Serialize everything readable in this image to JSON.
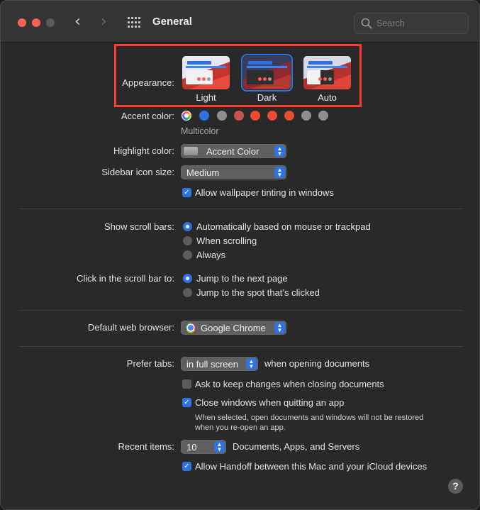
{
  "window": {
    "title": "General"
  },
  "toolbar": {
    "back_glyph": "‹",
    "forward_glyph": "›",
    "search_placeholder": "Search"
  },
  "appearance": {
    "label": "Appearance:",
    "options": [
      {
        "label": "Light",
        "selected": false
      },
      {
        "label": "Dark",
        "selected": true
      },
      {
        "label": "Auto",
        "selected": false
      }
    ]
  },
  "accent": {
    "label": "Accent color:",
    "selected_name": "Multicolor",
    "swatches": [
      "#2d73e3",
      "#8e8e8e",
      "#c8534a",
      "#ee4a33",
      "#ee4a33",
      "#e14e34",
      "#8e8e8e",
      "#8e8e8e"
    ]
  },
  "highlight": {
    "label": "Highlight color:",
    "value": "Accent Color"
  },
  "sidebar_size": {
    "label": "Sidebar icon size:",
    "value": "Medium"
  },
  "wallpaper_tinting": {
    "label": "Allow wallpaper tinting in windows",
    "checked": true
  },
  "scroll_bars": {
    "label": "Show scroll bars:",
    "options": [
      {
        "label": "Automatically based on mouse or trackpad",
        "selected": true
      },
      {
        "label": "When scrolling",
        "selected": false
      },
      {
        "label": "Always",
        "selected": false
      }
    ]
  },
  "scroll_click": {
    "label": "Click in the scroll bar to:",
    "options": [
      {
        "label": "Jump to the next page",
        "selected": true
      },
      {
        "label": "Jump to the spot that’s clicked",
        "selected": false
      }
    ]
  },
  "browser": {
    "label": "Default web browser:",
    "value": "Google Chrome"
  },
  "tabs": {
    "label": "Prefer tabs:",
    "value": "in full screen",
    "suffix": "when opening documents"
  },
  "ask_keep_changes": {
    "label": "Ask to keep changes when closing documents",
    "checked": false
  },
  "close_windows": {
    "label": "Close windows when quitting an app",
    "checked": true,
    "note_line1": "When selected, open documents and windows will not be restored",
    "note_line2": "when you re-open an app."
  },
  "recent_items": {
    "label": "Recent items:",
    "value": "10",
    "suffix": "Documents, Apps, and Servers"
  },
  "handoff": {
    "label": "Allow Handoff between this Mac and your iCloud devices",
    "checked": true
  },
  "help": {
    "glyph": "?"
  },
  "colors": {
    "accent": "#2d73e3",
    "highlight_box": "#ff3b2f"
  }
}
